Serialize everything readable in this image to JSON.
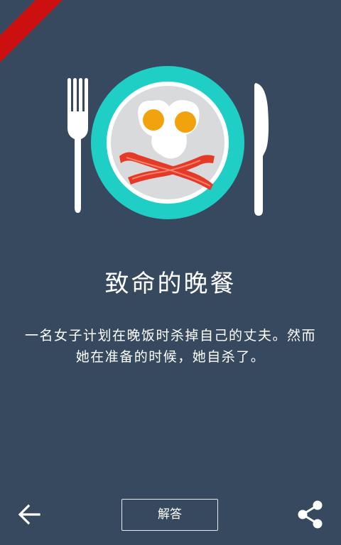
{
  "puzzle": {
    "title": "致命的晚餐",
    "description_lines": [
      "一名女子计划在晚饭时杀掉自己的丈夫。然而",
      "她在准备的时候，她自杀了。"
    ]
  },
  "toolbar": {
    "back_icon": "arrow-left-icon",
    "answer_label": "解答",
    "share_icon": "share-icon"
  },
  "illustration": {
    "icons": [
      "fork-icon",
      "plate-icon",
      "fried-eggs-icon",
      "bacon-icon",
      "knife-icon"
    ]
  },
  "colors": {
    "background": "#36495e",
    "plate_rim": "#1fcfc6",
    "plate_inner": "#d9dadc",
    "egg_yolk": "#f2a20c",
    "bacon": "#e53a27",
    "ribbon": "#cc0f0f"
  }
}
